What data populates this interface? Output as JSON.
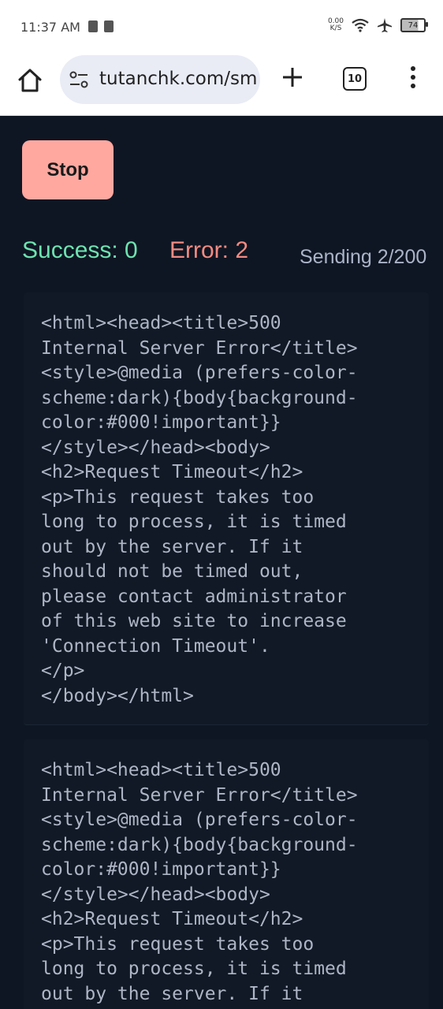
{
  "status_bar": {
    "time": "11:37 AM",
    "net_speed_value": "0.00",
    "net_speed_unit": "K/S",
    "battery": "74",
    "icons": [
      "sim-icon",
      "sd-card-icon",
      "wifi-icon",
      "airplane-icon",
      "battery-icon"
    ]
  },
  "browser": {
    "url": "tutanchk.com/sm",
    "tab_count": "10",
    "icons": [
      "home-icon",
      "site-settings-icon",
      "new-tab-icon",
      "tab-switcher-icon",
      "more-menu-icon"
    ]
  },
  "controls": {
    "stop_label": "Stop",
    "success_text": "Success: 0",
    "error_text": "Error: 2",
    "sending_text": "Sending 2/200"
  },
  "colors": {
    "background": "#0f1623",
    "stop_button": "#ffa8a0",
    "success": "#6ee3b0",
    "error": "#f28b82",
    "sending": "#aab4c8",
    "code_text": "#aeb6c6"
  },
  "responses": [
    {
      "body": "<html><head><title>500\nInternal Server Error</title>\n<style>@media (prefers-color-\nscheme:dark){body{background-\ncolor:#000!important}}\n</style></head><body>\n<h2>Request Timeout</h2>\n<p>This request takes too\nlong to process, it is timed\nout by the server. If it\nshould not be timed out,\nplease contact administrator\nof this web site to increase\n'Connection Timeout'.\n</p>\n</body></html>"
    },
    {
      "body": "<html><head><title>500\nInternal Server Error</title>\n<style>@media (prefers-color-\nscheme:dark){body{background-\ncolor:#000!important}}\n</style></head><body>\n<h2>Request Timeout</h2>\n<p>This request takes too\nlong to process, it is timed\nout by the server. If it\nshould not be timed out,"
    }
  ]
}
